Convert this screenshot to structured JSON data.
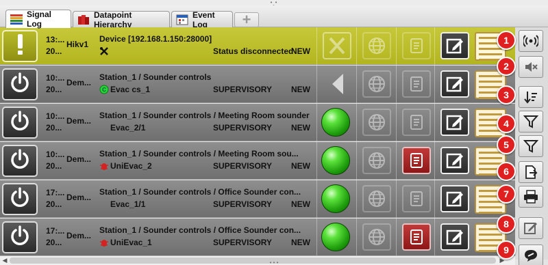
{
  "tabs": [
    {
      "label": "Signal Log",
      "icon": "signal-log-icon",
      "active": true
    },
    {
      "label": "Datapoint Hierarchy",
      "icon": "datapoint-hierarchy-icon",
      "active": false
    },
    {
      "label": "Event Log",
      "icon": "event-log-icon",
      "active": false
    }
  ],
  "add_tab_label": "+",
  "rows": [
    {
      "time_line1": "13:...",
      "time_line2": "20...",
      "source": "Hikv1",
      "path": "Device [192.168.1.150:28000]",
      "sub_name": "",
      "status": "Status disconnected",
      "state": "NEW",
      "style": "yellow",
      "status_icon": "exclamation-icon"
    },
    {
      "time_line1": "10:...",
      "time_line2": "20...",
      "source": "Dem...",
      "path": "Station_1 / Sounder controls",
      "sub_name": "Evac cs_1",
      "status": "SUPERVISORY",
      "state": "NEW",
      "style": "grey",
      "status_icon": "power-icon"
    },
    {
      "time_line1": "10:...",
      "time_line2": "20...",
      "source": "Dem...",
      "path": "Station_1 / Sounder controls / Meeting Room sounder",
      "sub_name": "Evac_2/1",
      "status": "SUPERVISORY",
      "state": "NEW",
      "style": "grey",
      "status_icon": "power-icon"
    },
    {
      "time_line1": "10:...",
      "time_line2": "20...",
      "source": "Dem...",
      "path": "Station_1 / Sounder controls / Meeting Room sou...",
      "sub_name": "UniEvac_2",
      "status": "SUPERVISORY",
      "state": "NEW",
      "style": "grey",
      "status_icon": "power-icon"
    },
    {
      "time_line1": "17:...",
      "time_line2": "20...",
      "source": "Dem...",
      "path": "Station_1 / Sounder controls / Office Sounder con...",
      "sub_name": "Evac_1/1",
      "status": "SUPERVISORY",
      "state": "NEW",
      "style": "grey",
      "status_icon": "power-icon"
    },
    {
      "time_line1": "17:...",
      "time_line2": "20...",
      "source": "Dem...",
      "path": "Station_1 / Sounder controls / Office Sounder con...",
      "sub_name": "UniEvac_1",
      "status": "SUPERVISORY",
      "state": "NEW",
      "style": "grey",
      "status_icon": "power-icon"
    }
  ],
  "toolbar": [
    {
      "name": "broadcast-icon"
    },
    {
      "name": "mute-icon"
    },
    {
      "name": "sort-icon"
    },
    {
      "name": "filter-icon"
    },
    {
      "name": "filter-icon"
    },
    {
      "name": "export-icon"
    },
    {
      "name": "print-icon"
    },
    {
      "name": "edit-icon"
    },
    {
      "name": "comment-icon"
    }
  ],
  "callouts": [
    "1",
    "2",
    "3",
    "4",
    "5",
    "6",
    "7",
    "8",
    "9"
  ],
  "colors": {
    "row_yellow": "#b8ba25",
    "row_grey": "#7f7f7f",
    "callout": "#e02020",
    "ack_red": "#b22a2a",
    "ok_green": "#3fc21f"
  }
}
